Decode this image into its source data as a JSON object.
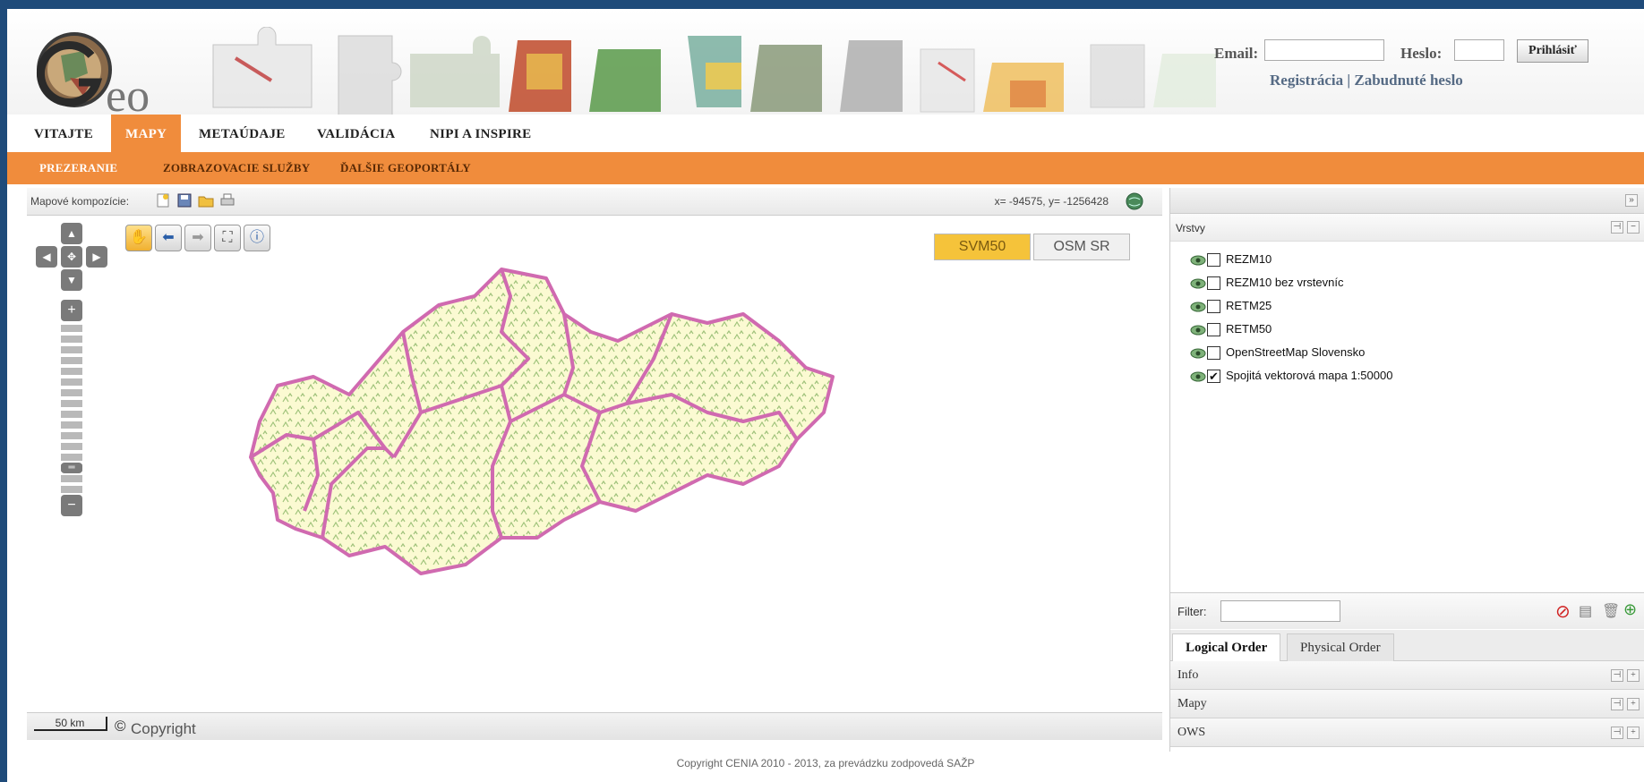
{
  "header": {
    "email_label": "Email:",
    "email_value": "",
    "password_label": "Heslo:",
    "password_value": "",
    "login_button": "Prihlásiť",
    "register_link": "Registrácia",
    "separator": "|",
    "forgot_link": "Zabudnuté heslo"
  },
  "main_nav": {
    "items": [
      "VITAJTE",
      "MAPY",
      "METAÚDAJE",
      "VALIDÁCIA",
      "NIPI A INSPIRE"
    ],
    "active": "MAPY"
  },
  "sub_nav": {
    "items": [
      "PREZERANIE",
      "ZOBRAZOVACIE SLUŽBY",
      "ĎALŠIE GEOPORTÁLY"
    ],
    "active": "PREZERANIE"
  },
  "map": {
    "compositions_label": "Mapové kompozície:",
    "coordinates": "x= -94575, y= -1256428",
    "basemaps": [
      "SVM50",
      "OSM SR"
    ],
    "active_basemap": "SVM50",
    "scale_label": "50 km",
    "copyright_label": "Copyright",
    "zoom_level": 3,
    "zoom_levels": 16
  },
  "layers_panel": {
    "title": "Vrstvy",
    "layers": [
      {
        "name": "REZM10",
        "checked": false
      },
      {
        "name": "REZM10 bez vrstevníc",
        "checked": false
      },
      {
        "name": "RETM25",
        "checked": false
      },
      {
        "name": "RETM50",
        "checked": false
      },
      {
        "name": "OpenStreetMap Slovensko",
        "checked": false
      },
      {
        "name": "Spojitá vektorová mapa 1:50000",
        "checked": true
      }
    ],
    "filter_label": "Filter:",
    "filter_value": "",
    "tabs": [
      "Logical Order",
      "Physical Order"
    ],
    "active_tab": "Logical Order",
    "sections": [
      "Info",
      "Mapy",
      "OWS"
    ]
  },
  "footer": {
    "text": "Copyright CENIA 2010 - 2013, za prevádzku zodpovedá SAŽP"
  },
  "colors": {
    "accent_orange": "#f08c3c",
    "basemap_active": "#f5c33a",
    "region_border": "#d06ab0",
    "map_fill": "#fbfad2",
    "terrain_green": "#9fc27a"
  }
}
